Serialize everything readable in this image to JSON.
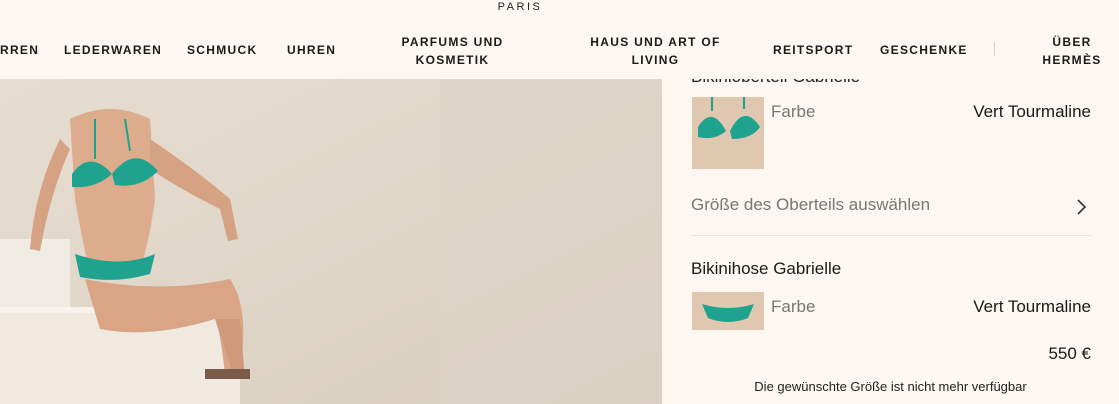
{
  "header": {
    "brand_sub": "PARIS",
    "nav": [
      {
        "label": "RREN"
      },
      {
        "label": "LEDERWAREN"
      },
      {
        "label": "SCHMUCK"
      },
      {
        "label": "UHREN"
      },
      {
        "label": "PARFUMS UND KOSMETIK"
      },
      {
        "label": "HAUS UND ART OF LIVING"
      },
      {
        "label": "REITSPORT"
      },
      {
        "label": "GESCHENKE"
      },
      {
        "label": "ÜBER HERMÈS"
      }
    ]
  },
  "hero": {
    "alt": "Model wearing green tropical print bikini seated on beige steps"
  },
  "panel": {
    "top_item": {
      "title": "Bikinioberteil Gabrielle",
      "color_label": "Farbe",
      "color_value": "Vert Tourmaline",
      "size_select": "Größe des Oberteils auswählen"
    },
    "bottom_item": {
      "title": "Bikinihose Gabrielle",
      "color_label": "Farbe",
      "color_value": "Vert Tourmaline",
      "price": "550 €",
      "availability": "Die gewünschte Größe ist nicht mehr verfügbar"
    }
  },
  "colors": {
    "background": "#fcf7f1",
    "bikini_green": "#1fa38e"
  }
}
